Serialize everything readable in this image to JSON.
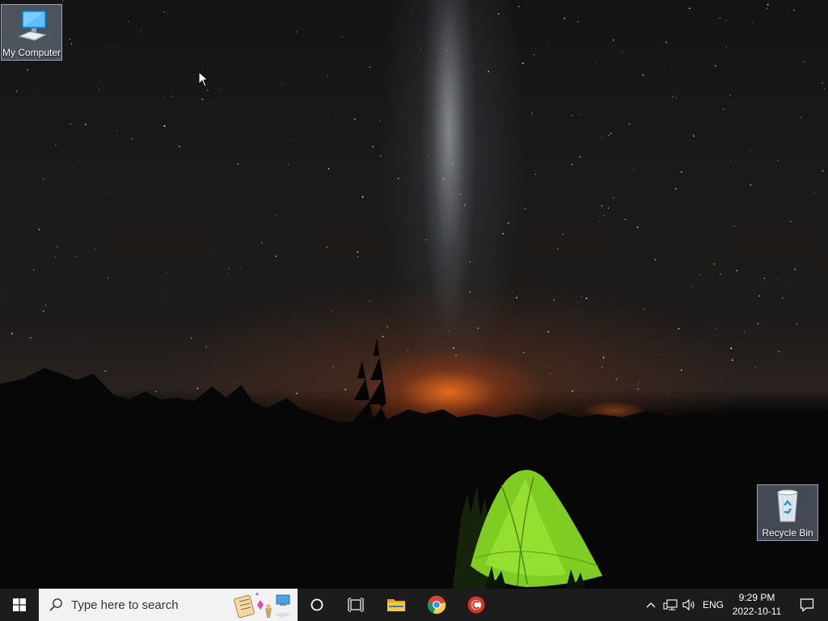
{
  "desktop": {
    "icons": [
      {
        "label": "My Computer",
        "icon": "computer-icon"
      },
      {
        "label": "Recycle Bin",
        "icon": "recycle-bin-icon"
      }
    ]
  },
  "taskbar": {
    "start_icon": "windows-logo-icon",
    "search": {
      "placeholder": "Type here to search"
    },
    "cortana_icon": "cortana-circle-icon",
    "task_view_icon": "task-view-icon",
    "pinned_apps": [
      {
        "name": "File Explorer",
        "icon": "folder-icon"
      },
      {
        "name": "Google Chrome",
        "icon": "chrome-icon"
      },
      {
        "name": "CCleaner",
        "icon": "ccleaner-icon"
      }
    ],
    "tray": {
      "chevron_icon": "chevron-up-icon",
      "network_icon": "network-icon",
      "volume_icon": "volume-icon",
      "language": "ENG",
      "time": "9:29 PM",
      "date": "2022-10-11",
      "notification_icon": "notification-icon"
    }
  },
  "colors": {
    "taskbar_bg": "#1c1c1c",
    "search_bg": "#f2f2f2",
    "tent_green": "#8fdc2a",
    "horizon_glow": "#e96e1e"
  }
}
